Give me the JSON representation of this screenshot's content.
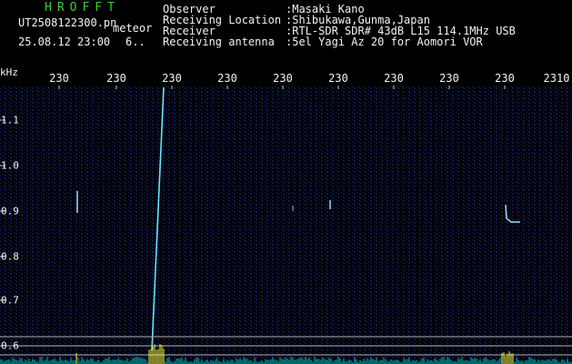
{
  "header": {
    "brand": "HROFFT",
    "filename": "UT2508122300.pn",
    "tag": "meteor",
    "datetime": "25.08.12 23:00",
    "count": "6..",
    "info": [
      {
        "label": "Observer",
        "value": ":Masaki Kano"
      },
      {
        "label": "Receiving Location",
        "value": ":Shibukawa,Gunma,Japan"
      },
      {
        "label": "Receiver",
        "value": ":RTL-SDR SDR# 43dB L15 114.1MHz USB"
      },
      {
        "label": "Receiving antenna",
        "value": ":5el Yagi Az 20 for Aomori VOR"
      }
    ]
  },
  "axis": {
    "y_unit": "kHz",
    "y_ticks": [
      "1.1",
      "1.0",
      "0.9",
      "0.8",
      "0.7",
      "0.6"
    ],
    "x_ticks": [
      "230",
      "230",
      "230",
      "230",
      "230",
      "230",
      "230",
      "230",
      "230",
      "2310"
    ]
  },
  "colors": {
    "background": "#000000",
    "noise": "#1a2a8c",
    "signal": "#9fdcff",
    "meteor": "#5ee8ff",
    "brand": "#35d035",
    "text": "#f3f3f3",
    "spectrum": "#00c8c8",
    "spectrum_peak": "#ffff40"
  }
}
